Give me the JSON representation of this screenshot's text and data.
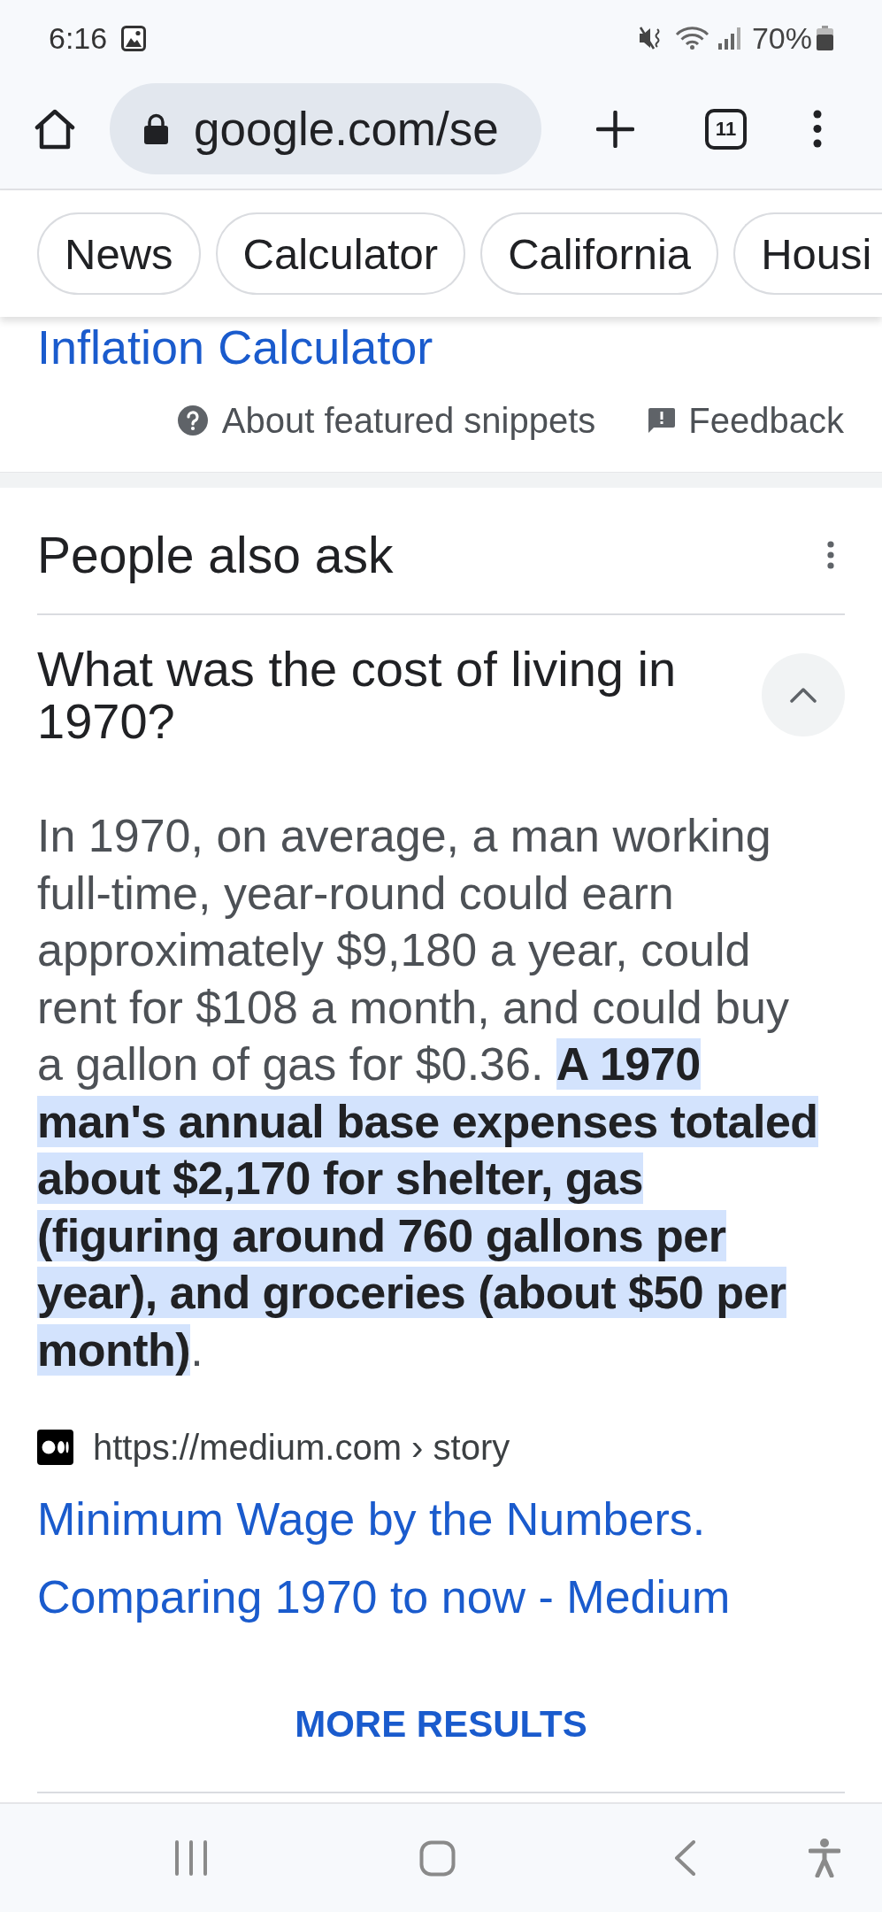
{
  "status_bar": {
    "time": "6:16",
    "battery": "70%"
  },
  "browser_toolbar": {
    "url": "google.com/se",
    "tab_count": "11"
  },
  "chips": [
    {
      "label": "News"
    },
    {
      "label": "Calculator"
    },
    {
      "label": "California"
    },
    {
      "label": "Housi"
    }
  ],
  "partial_result": {
    "title": "Inflation Calculator"
  },
  "snippet_footer": {
    "about": "About featured snippets",
    "feedback": "Feedback"
  },
  "people_also_ask": {
    "title": "People also ask",
    "questions": [
      {
        "question": "What was the cost of living in 1970?",
        "expanded": true,
        "answer": "In 1970, on average, a man working full-time, year-round could earn approximately $9,180 a year, could rent for $108 a month, and could buy a gallon of gas for $0.36. **A 1970 man's annual base expenses totaled about $2,170 for shelter, gas (figuring around 760 gallons per year), and groceries (about $50 per month)**.",
        "source_url": "https://medium.com › story",
        "source_title": "Minimum Wage by the Numbers. Comparing 1970 to now - Medium"
      }
    ],
    "more_button": "MORE RESULTS"
  }
}
